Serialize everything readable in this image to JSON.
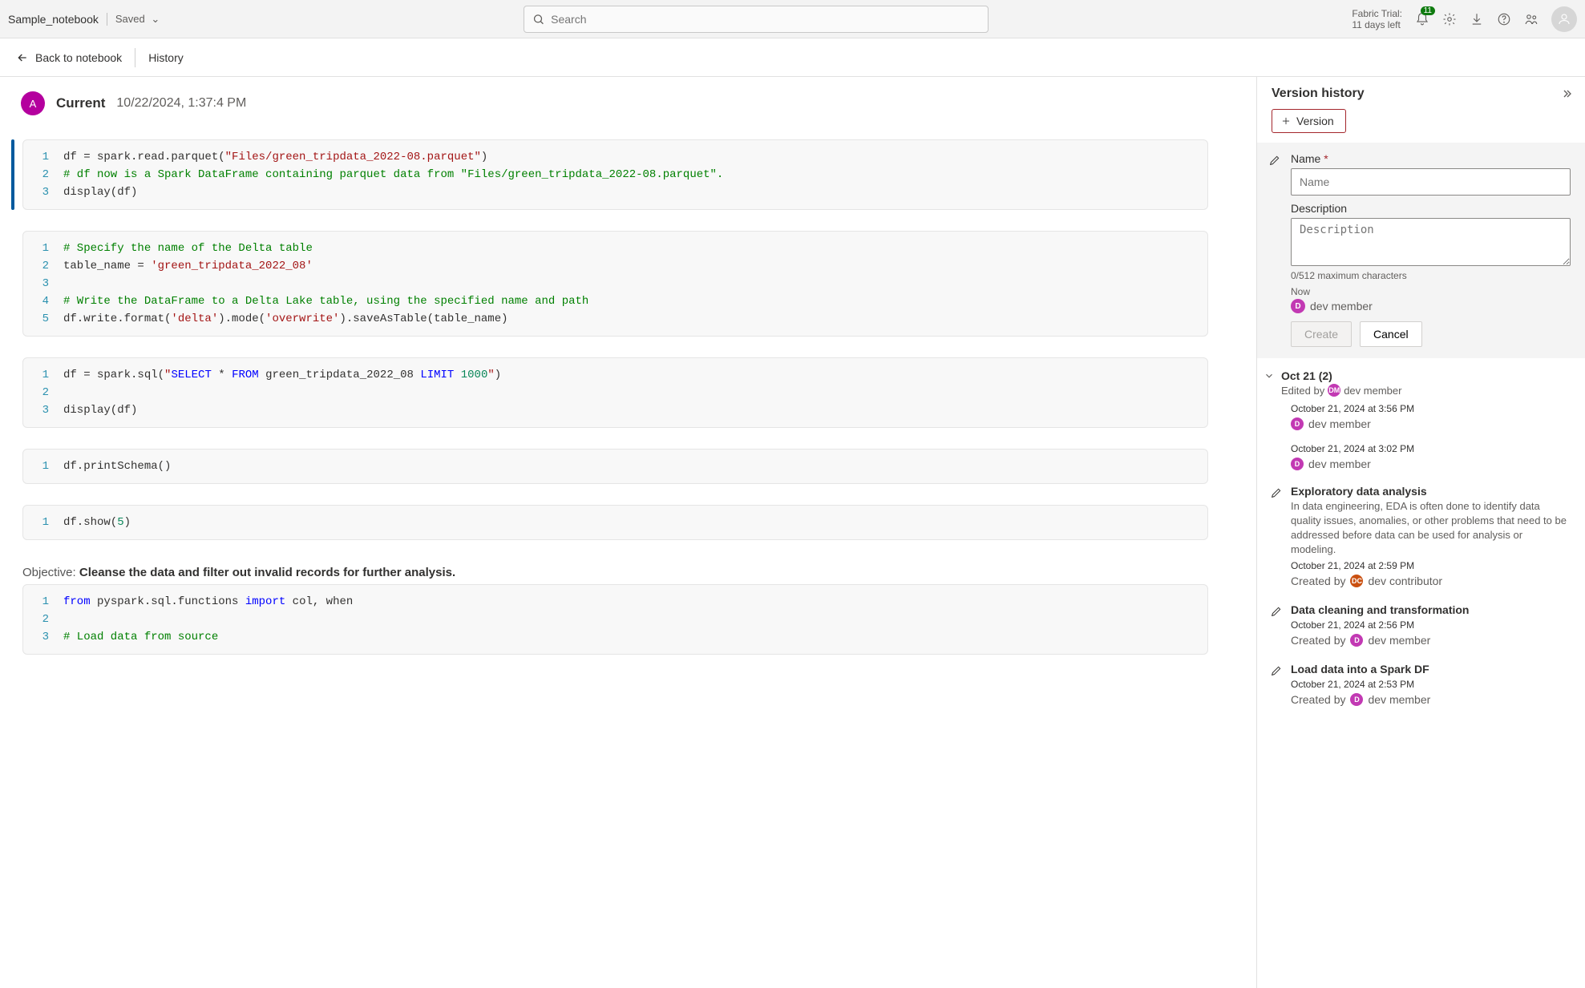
{
  "top": {
    "notebook_title": "Sample_notebook",
    "saved_label": "Saved",
    "search_placeholder": "Search",
    "trial_line1": "Fabric Trial:",
    "trial_line2": "11 days left",
    "notif_count": "11"
  },
  "sub": {
    "back_label": "Back to notebook",
    "history_label": "History"
  },
  "current": {
    "avatar_initial": "A",
    "title": "Current",
    "timestamp": "10/22/2024, 1:37:4 PM"
  },
  "cells": {
    "c1": {
      "l1a": "df = spark.read.parquet(",
      "l1b": "\"Files/green_tripdata_2022-08.parquet\"",
      "l1c": ")",
      "l2": "# df now is a Spark DataFrame containing parquet data from \"Files/green_tripdata_2022-08.parquet\".",
      "l3": "display(df)"
    },
    "c2": {
      "l1": "# Specify the name of the Delta table",
      "l2a": "table_name = ",
      "l2b": "'green_tripdata_2022_08'",
      "l4": "# Write the DataFrame to a Delta Lake table, using the specified name and path",
      "l5a": "df.write.format(",
      "l5b": "'delta'",
      "l5c": ").mode(",
      "l5d": "'overwrite'",
      "l5e": ").saveAsTable(table_name)"
    },
    "c3": {
      "l1a": "df = spark.sql(",
      "l1q1": "\"",
      "l1kw1": "SELECT",
      "l1m1": " * ",
      "l1kw2": "FROM",
      "l1m2": " green_tripdata_2022_08 ",
      "l1kw3": "LIMIT",
      "l1sp": " ",
      "l1num": "1000",
      "l1q2": "\"",
      "l1b": ")",
      "l3": "display(df)"
    },
    "c4": {
      "l1": "df.printSchema()"
    },
    "c5": {
      "l1a": "df.show(",
      "l1n": "5",
      "l1b": ")"
    },
    "md": {
      "label": "Objective: ",
      "bold": "Cleanse the data and filter out invalid records for further analysis."
    },
    "c6": {
      "l1a": "from",
      "l1b": " pyspark.sql.functions ",
      "l1c": "import",
      "l1d": " col, when",
      "l3": "# Load data from source"
    }
  },
  "side": {
    "title": "Version history",
    "add_label": "Version",
    "form": {
      "name_label": "Name",
      "name_placeholder": "Name",
      "desc_label": "Description",
      "desc_placeholder": "Description",
      "charcount": "0/512 maximum characters",
      "now_label": "Now",
      "member_initial": "D",
      "member_label": "dev member",
      "create_label": "Create",
      "cancel_label": "Cancel"
    },
    "group": {
      "title": "Oct 21 (2)",
      "edited_by": "Edited by",
      "editor_initial": "DM",
      "editor_name": "dev member"
    },
    "items": [
      {
        "time": "October 21, 2024 at 3:56 PM",
        "initial": "D",
        "user": "dev member"
      },
      {
        "time": "October 21, 2024 at 3:02 PM",
        "initial": "D",
        "user": "dev member"
      }
    ],
    "named": [
      {
        "title": "Exploratory data analysis",
        "desc": "In data engineering, EDA is often done to identify data quality issues, anomalies, or other problems that need to be addressed before data can be used for analysis or modeling.",
        "time": "October 21, 2024 at 2:59 PM",
        "created_by": "Created by",
        "initial": "DC",
        "user": "dev contributor",
        "dot": "orange"
      },
      {
        "title": "Data cleaning and transformation",
        "desc": "",
        "time": "October 21, 2024 at 2:56 PM",
        "created_by": "Created by",
        "initial": "D",
        "user": "dev member",
        "dot": "pink"
      },
      {
        "title": "Load data into a Spark DF",
        "desc": "",
        "time": "October 21, 2024 at 2:53 PM",
        "created_by": "Created by",
        "initial": "D",
        "user": "dev member",
        "dot": "pink"
      }
    ]
  }
}
